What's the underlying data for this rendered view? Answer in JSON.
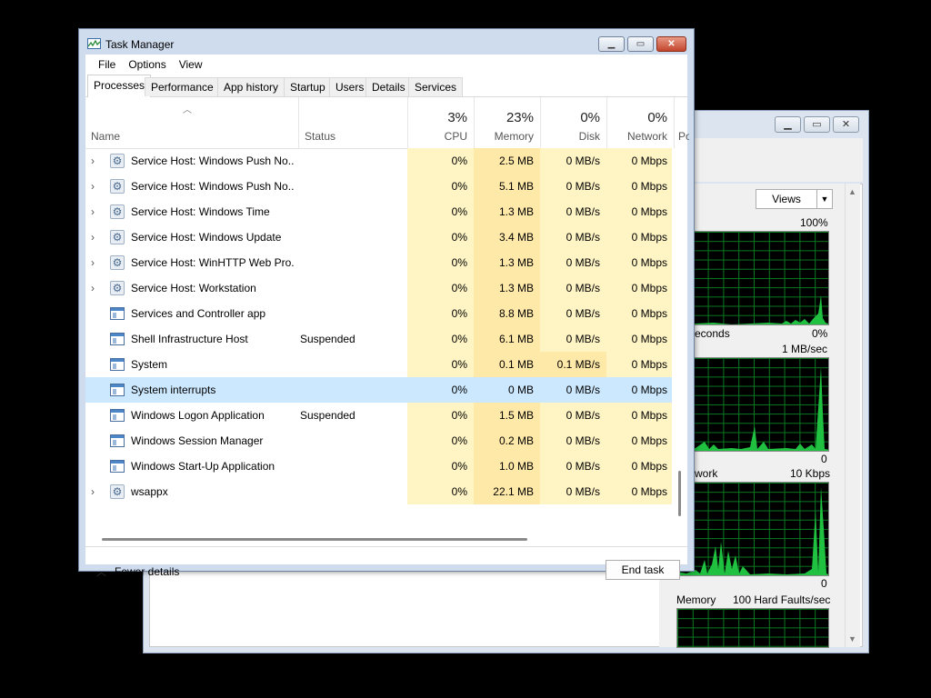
{
  "task_manager": {
    "title": "Task Manager",
    "menu": [
      "File",
      "Options",
      "View"
    ],
    "tabs": [
      "Processes",
      "Performance",
      "App history",
      "Startup",
      "Users",
      "Details",
      "Services"
    ],
    "active_tab": "Processes",
    "columns": {
      "name": "Name",
      "status": "Status",
      "cpu": {
        "percent": "3%",
        "label": "CPU"
      },
      "memory": {
        "percent": "23%",
        "label": "Memory"
      },
      "disk": {
        "percent": "0%",
        "label": "Disk"
      },
      "network": {
        "percent": "0%",
        "label": "Network"
      },
      "power": "Po"
    },
    "rows": [
      {
        "expand": "›",
        "icon": "gear-icon",
        "name": "Service Host: Windows Push No...",
        "status": "",
        "cpu": "0%",
        "memory": "2.5 MB",
        "disk": "0 MB/s",
        "network": "0 Mbps"
      },
      {
        "expand": "›",
        "icon": "gear-icon",
        "name": "Service Host: Windows Push No...",
        "status": "",
        "cpu": "0%",
        "memory": "5.1 MB",
        "disk": "0 MB/s",
        "network": "0 Mbps"
      },
      {
        "expand": "›",
        "icon": "gear-icon",
        "name": "Service Host: Windows Time",
        "status": "",
        "cpu": "0%",
        "memory": "1.3 MB",
        "disk": "0 MB/s",
        "network": "0 Mbps"
      },
      {
        "expand": "›",
        "icon": "gear-icon",
        "name": "Service Host: Windows Update",
        "status": "",
        "cpu": "0%",
        "memory": "3.4 MB",
        "disk": "0 MB/s",
        "network": "0 Mbps"
      },
      {
        "expand": "›",
        "icon": "gear-icon",
        "name": "Service Host: WinHTTP Web Pro...",
        "status": "",
        "cpu": "0%",
        "memory": "1.3 MB",
        "disk": "0 MB/s",
        "network": "0 Mbps"
      },
      {
        "expand": "›",
        "icon": "gear-icon",
        "name": "Service Host: Workstation",
        "status": "",
        "cpu": "0%",
        "memory": "1.3 MB",
        "disk": "0 MB/s",
        "network": "0 Mbps"
      },
      {
        "expand": "",
        "icon": "window-icon",
        "name": "Services and Controller app",
        "status": "",
        "cpu": "0%",
        "memory": "8.8 MB",
        "disk": "0 MB/s",
        "network": "0 Mbps"
      },
      {
        "expand": "",
        "icon": "window-icon",
        "name": "Shell Infrastructure Host",
        "status": "Suspended",
        "cpu": "0%",
        "memory": "6.1 MB",
        "disk": "0 MB/s",
        "network": "0 Mbps"
      },
      {
        "expand": "",
        "icon": "window-icon",
        "name": "System",
        "status": "",
        "cpu": "0%",
        "memory": "0.1 MB",
        "disk": "0.1 MB/s",
        "network": "0 Mbps"
      },
      {
        "expand": "",
        "icon": "window-icon",
        "name": "System interrupts",
        "status": "",
        "cpu": "0%",
        "memory": "0 MB",
        "disk": "0 MB/s",
        "network": "0 Mbps",
        "selected": true
      },
      {
        "expand": "",
        "icon": "window-icon",
        "name": "Windows Logon Application",
        "status": "Suspended",
        "cpu": "0%",
        "memory": "1.5 MB",
        "disk": "0 MB/s",
        "network": "0 Mbps"
      },
      {
        "expand": "",
        "icon": "window-icon",
        "name": "Windows Session Manager",
        "status": "",
        "cpu": "0%",
        "memory": "0.2 MB",
        "disk": "0 MB/s",
        "network": "0 Mbps"
      },
      {
        "expand": "",
        "icon": "window-icon",
        "name": "Windows Start-Up Application",
        "status": "",
        "cpu": "0%",
        "memory": "1.0 MB",
        "disk": "0 MB/s",
        "network": "0 Mbps"
      },
      {
        "expand": "›",
        "icon": "gear-icon",
        "name": "wsappx",
        "status": "",
        "cpu": "0%",
        "memory": "22.1 MB",
        "disk": "0 MB/s",
        "network": "0 Mbps"
      }
    ],
    "footer": {
      "fewer_details": "Fewer details",
      "end_task": "End task"
    }
  },
  "resource_monitor": {
    "views_button": "Views",
    "graphs": [
      {
        "left_label": "",
        "right_label": "100%",
        "bottom_left": "econds",
        "bottom_right": "0%"
      },
      {
        "left_label": "",
        "right_label": "1 MB/sec",
        "bottom_left": "",
        "bottom_right": "0"
      },
      {
        "left_label": "work",
        "right_label": "10 Kbps",
        "bottom_left": "",
        "bottom_right": "0"
      },
      {
        "left_label": "Memory",
        "right_label": "100 Hard Faults/sec",
        "bottom_left": "",
        "bottom_right": ""
      }
    ]
  },
  "colors": {
    "cpu_heat": "#fff4c4",
    "memory_heat": "#ffe9a8",
    "selected_row": "#cce8ff",
    "graph_line": "#20c040"
  }
}
